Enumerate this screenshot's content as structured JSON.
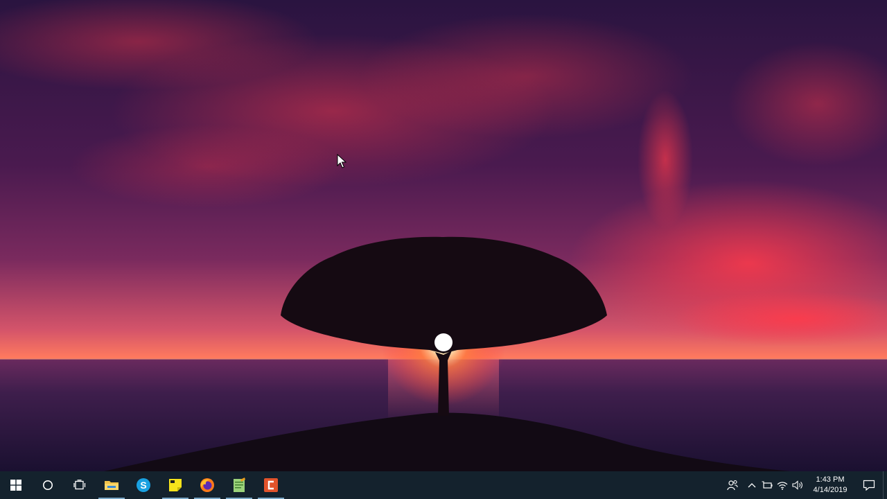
{
  "desktop": {
    "wallpaper": "sunset-tree-over-ocean",
    "colors": {
      "sky_top": "#2a1440",
      "cloud_red": "#e0344a",
      "horizon": "#ff6a5a",
      "sea": "#3a1f4a",
      "sun": "#fff6d0"
    }
  },
  "taskbar": {
    "background": "#14222d",
    "start_icon": "windows-logo-icon",
    "search_icon": "cortana-circle-icon",
    "task_view_icon": "task-view-icon",
    "pinned": [
      {
        "name": "file-explorer",
        "icon": "folder-icon",
        "running": true
      },
      {
        "name": "skype",
        "icon": "skype-icon",
        "running": false
      },
      {
        "name": "sticky-notes",
        "icon": "sticky-notes-icon",
        "running": true
      },
      {
        "name": "firefox",
        "icon": "firefox-icon",
        "running": true
      },
      {
        "name": "notepad-plus",
        "icon": "notepad-icon",
        "running": true
      },
      {
        "name": "camtasia",
        "icon": "camtasia-icon",
        "running": true
      }
    ]
  },
  "tray": {
    "icons": [
      "people-icon",
      "chevron-up-icon",
      "battery-icon",
      "wifi-icon",
      "volume-icon"
    ],
    "clock": {
      "time": "1:43 PM",
      "date": "4/14/2019"
    },
    "notification_icon": "action-center-icon"
  }
}
